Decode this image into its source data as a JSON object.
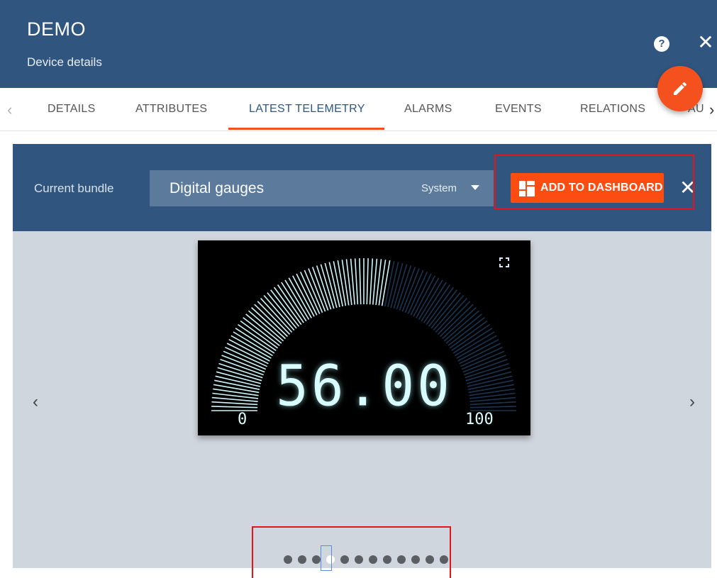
{
  "header": {
    "title": "DEMO",
    "subtitle": "Device details"
  },
  "tabs": [
    {
      "label": "DETAILS"
    },
    {
      "label": "ATTRIBUTES"
    },
    {
      "label": "LATEST TELEMETRY",
      "active": true
    },
    {
      "label": "ALARMS"
    },
    {
      "label": "EVENTS"
    },
    {
      "label": "RELATIONS"
    },
    {
      "label": "AU"
    }
  ],
  "bundle": {
    "label": "Current bundle",
    "value": "Digital gauges",
    "scope": "System"
  },
  "add_button": {
    "label": "ADD TO DASHBOARD"
  },
  "gauge": {
    "value": "56.00",
    "min": "0",
    "max": "100",
    "fraction": 0.56
  },
  "carousel": {
    "dot_count": 12,
    "active_index": 3
  },
  "colors": {
    "header_bg": "#305680",
    "accent": "#f4511e",
    "button_bg": "#fb4d11",
    "panel_bg": "#d0d6dd",
    "highlight": "#e3141a"
  }
}
